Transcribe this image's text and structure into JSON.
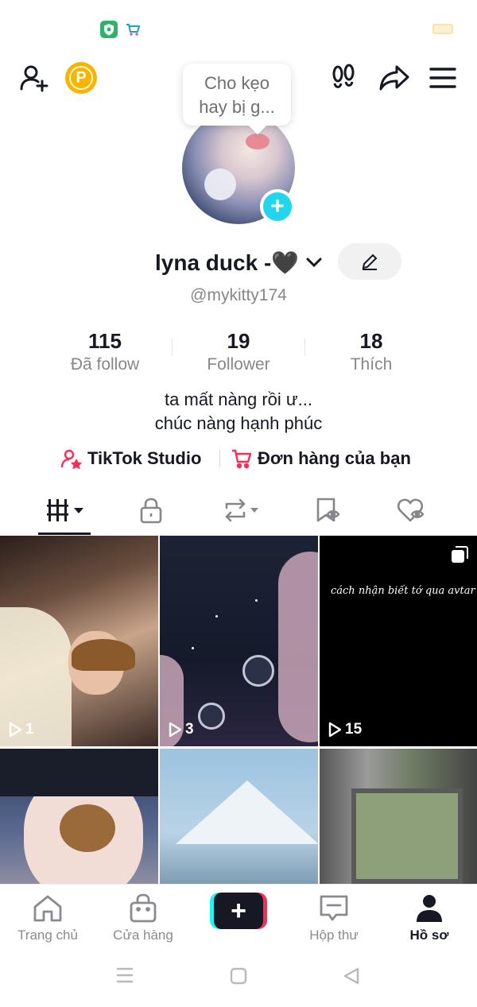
{
  "status_bar": {
    "icons": [
      "shield-app-icon",
      "cart-app-icon",
      "battery-icon"
    ]
  },
  "header": {
    "icons": [
      "add-friend-icon",
      "coin-icon",
      "footprints-icon",
      "share-icon",
      "menu-icon"
    ],
    "coin_label": "P"
  },
  "tooltip": {
    "line1": "Cho kẹo",
    "line2": "hay bị g..."
  },
  "profile": {
    "display_name": "lyna duck -🖤",
    "username": "@mykitty174",
    "add_avatar_label": "+"
  },
  "stats": [
    {
      "value": "115",
      "label": "Đã follow"
    },
    {
      "value": "19",
      "label": "Follower"
    },
    {
      "value": "18",
      "label": "Thích"
    }
  ],
  "bio": {
    "line1": "ta mất nàng rồi ư...",
    "line2": "chúc nàng hạnh phúc"
  },
  "links": [
    {
      "label": "TikTok Studio",
      "icon": "creator-studio-icon"
    },
    {
      "label": "Đơn hàng của bạn",
      "icon": "shopping-cart-icon"
    }
  ],
  "tabs": [
    {
      "icon": "videos-grid-icon",
      "active": true
    },
    {
      "icon": "lock-icon",
      "active": false
    },
    {
      "icon": "repost-icon",
      "active": false
    },
    {
      "icon": "favorites-icon",
      "active": false
    },
    {
      "icon": "liked-icon",
      "active": false
    }
  ],
  "videos": [
    {
      "views": "1"
    },
    {
      "views": "3"
    },
    {
      "views": "15",
      "overlay_text": "cách nhận biết tớ qua avtar"
    },
    {
      "views": ""
    },
    {
      "views": ""
    },
    {
      "views": ""
    }
  ],
  "bottom_nav": [
    {
      "label": "Trang chủ",
      "icon": "home-icon",
      "active": false
    },
    {
      "label": "Cửa hàng",
      "icon": "shop-icon",
      "active": false
    },
    {
      "label": "",
      "icon": "create-icon",
      "active": false
    },
    {
      "label": "Hộp thư",
      "icon": "inbox-icon",
      "active": false
    },
    {
      "label": "Hồ sơ",
      "icon": "profile-icon",
      "active": true
    }
  ],
  "colors": {
    "accent_cyan": "#20d5ec",
    "accent_red": "#fe2c55",
    "coin": "#f9b400",
    "text_primary": "#161823",
    "text_secondary": "#86878b"
  }
}
